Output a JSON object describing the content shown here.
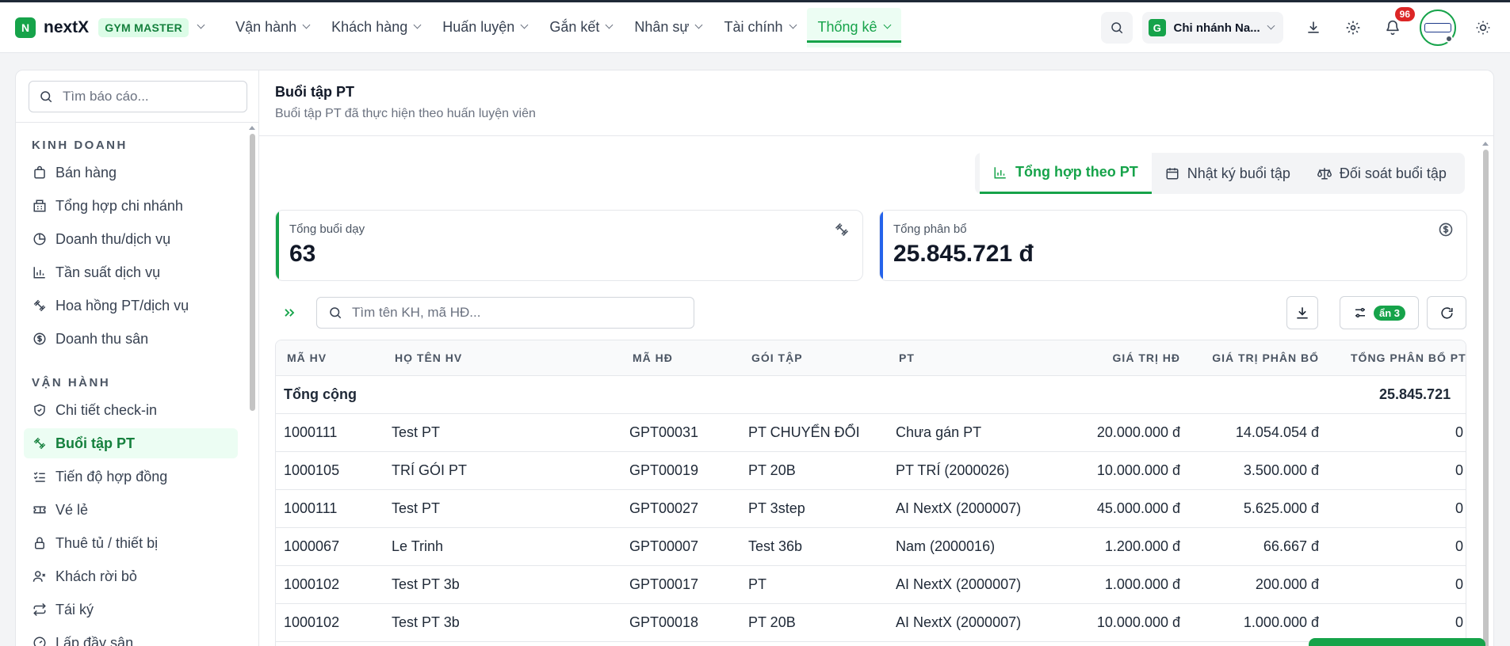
{
  "app": {
    "logo_letter": "N",
    "name": "nextX",
    "plan": "GYM MASTER"
  },
  "nav": [
    {
      "label": "Vận hành"
    },
    {
      "label": "Khách hàng"
    },
    {
      "label": "Huấn luyện"
    },
    {
      "label": "Gắn kết"
    },
    {
      "label": "Nhân sự"
    },
    {
      "label": "Tài chính"
    },
    {
      "label": "Thống kê",
      "active": true
    }
  ],
  "header_tools": {
    "branch_letter": "G",
    "branch_name": "Chi nhánh Na...",
    "notification_count": "96"
  },
  "sidebar": {
    "search_placeholder": "Tìm báo cáo...",
    "sections": [
      {
        "title": "KINH DOANH",
        "items": [
          {
            "label": "Bán hàng",
            "icon": "shopping-bag-icon"
          },
          {
            "label": "Tổng hợp chi nhánh",
            "icon": "building-icon"
          },
          {
            "label": "Doanh thu/dịch vụ",
            "icon": "pie-chart-icon"
          },
          {
            "label": "Tần suất dịch vụ",
            "icon": "bar-chart-icon"
          },
          {
            "label": "Hoa hồng PT/dịch vụ",
            "icon": "dumbbell-icon"
          },
          {
            "label": "Doanh thu sân",
            "icon": "dollar-circle-icon"
          }
        ]
      },
      {
        "title": "VẬN HÀNH",
        "items": [
          {
            "label": "Chi tiết check-in",
            "icon": "shield-check-icon"
          },
          {
            "label": "Buổi tập PT",
            "icon": "dumbbell-icon",
            "active": true
          },
          {
            "label": "Tiến độ hợp đồng",
            "icon": "list-check-icon"
          },
          {
            "label": "Vé lẻ",
            "icon": "ticket-icon"
          },
          {
            "label": "Thuê tủ / thiết bị",
            "icon": "lock-icon"
          },
          {
            "label": "Khách rời bỏ",
            "icon": "user-x-icon"
          },
          {
            "label": "Tái ký",
            "icon": "repeat-icon"
          },
          {
            "label": "Lấp đầy sân",
            "icon": "gauge-icon"
          }
        ]
      }
    ]
  },
  "page": {
    "title": "Buổi tập PT",
    "subtitle": "Buổi tập PT đã thực hiện theo huấn luyện viên"
  },
  "tabs": [
    {
      "label": "Tổng hợp theo PT",
      "icon": "bar-chart-icon",
      "active": true
    },
    {
      "label": "Nhật ký buổi tập",
      "icon": "calendar-icon"
    },
    {
      "label": "Đối soát buổi tập",
      "icon": "scale-icon"
    }
  ],
  "stats": [
    {
      "label": "Tổng buổi dạy",
      "value": "63",
      "icon": "dumbbell-icon"
    },
    {
      "label": "Tổng phân bổ",
      "value": "25.845.721 đ",
      "icon": "dollar-circle-icon"
    }
  ],
  "toolbar": {
    "search_placeholder": "Tìm tên KH, mã HĐ...",
    "hidden_label": "ẩn 3"
  },
  "table": {
    "columns": [
      "MÃ HV",
      "HỌ TÊN HV",
      "MÃ HĐ",
      "GÓI TẬP",
      "PT",
      "GIÁ TRỊ HĐ",
      "GIÁ TRỊ PHÂN BỔ",
      "TỔNG PHÂN BỔ PT"
    ],
    "total": {
      "label": "Tổng cộng",
      "value": "25.845.721"
    },
    "rows": [
      [
        "1000111",
        "Test PT",
        "GPT00031",
        "PT CHUYỂN ĐỔI",
        "Chưa gán PT",
        "20.000.000 đ",
        "14.054.054 đ",
        "0"
      ],
      [
        "1000105",
        "TRÍ GÓI PT",
        "GPT00019",
        "PT 20B",
        "PT TRÍ (2000026)",
        "10.000.000 đ",
        "3.500.000 đ",
        "0"
      ],
      [
        "1000111",
        "Test PT",
        "GPT00027",
        "PT 3step",
        "AI NextX (2000007)",
        "45.000.000 đ",
        "5.625.000 đ",
        "0"
      ],
      [
        "1000067",
        "Le Trinh",
        "GPT00007",
        "Test 36b",
        "Nam (2000016)",
        "1.200.000 đ",
        "66.667 đ",
        "0"
      ],
      [
        "1000102",
        "Test PT 3b",
        "GPT00017",
        "PT",
        "AI NextX (2000007)",
        "1.000.000 đ",
        "200.000 đ",
        "0"
      ],
      [
        "1000102",
        "Test PT 3b",
        "GPT00018",
        "PT 20B",
        "AI NextX (2000007)",
        "10.000.000 đ",
        "1.000.000 đ",
        "0"
      ]
    ]
  },
  "colors": {
    "accent": "#16a34a",
    "accent_light": "#ecfdf3",
    "badge_red": "#dc2626",
    "stat_blue": "#2563eb"
  }
}
